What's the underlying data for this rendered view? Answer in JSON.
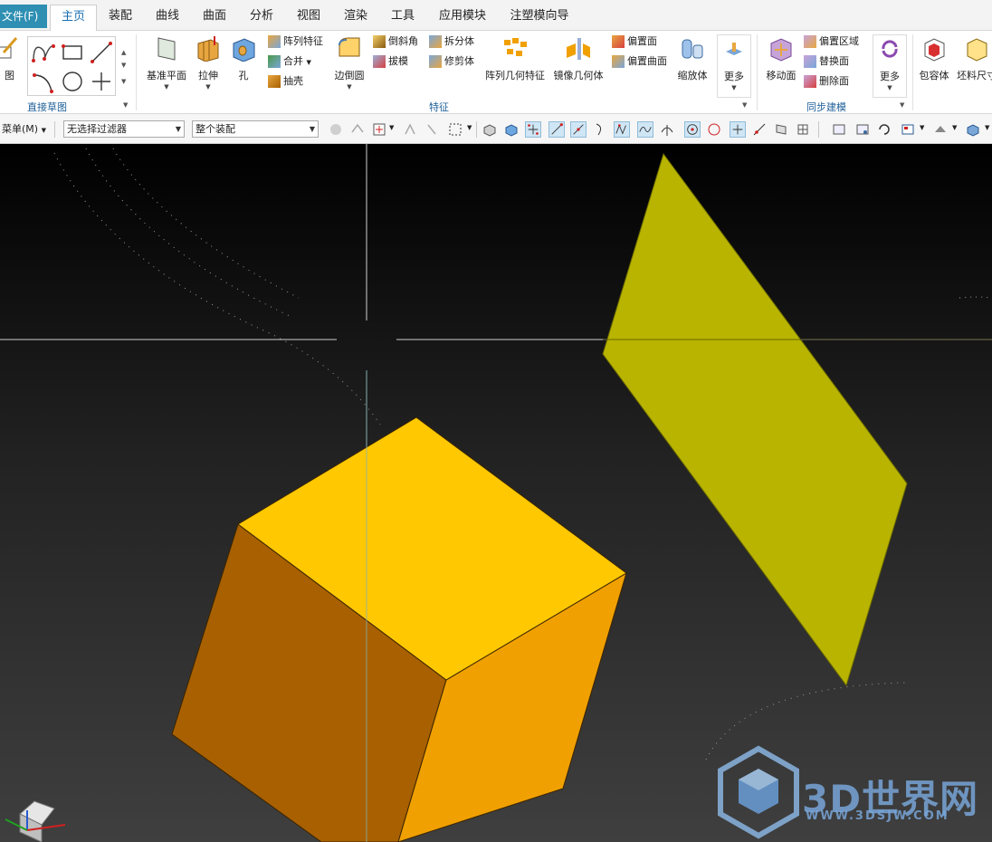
{
  "tabs": {
    "file": "文件(F)",
    "items": [
      "主页",
      "装配",
      "曲线",
      "曲面",
      "分析",
      "视图",
      "渲染",
      "工具",
      "应用模块",
      "注塑模向导"
    ],
    "active": "主页"
  },
  "ribbon": {
    "sketch_partial_label": "图",
    "groups": {
      "direct_sketch": "直接草图",
      "feature": "特征",
      "sync_modeling": "同步建模"
    },
    "feature": {
      "datum_plane": "基准平面",
      "extrude": "拉伸",
      "hole": "孔",
      "pattern_feature": "阵列特征",
      "unite": "合并",
      "shell": "抽壳",
      "edge_blend": "边倒圆",
      "chamfer": "倒斜角",
      "draft": "拔模",
      "split_body": "拆分体",
      "trim_body": "修剪体",
      "pattern_geometry": "阵列几何特征",
      "mirror_geometry": "镜像几何体",
      "offset_face": "偏置面",
      "offset_surface": "偏置曲面",
      "scale_body": "缩放体",
      "more": "更多"
    },
    "sync": {
      "move_face": "移动面",
      "offset_region": "偏置区域",
      "replace_face": "替换面",
      "delete_face": "删除面",
      "more": "更多"
    },
    "extra": {
      "bounding_body": "包容体",
      "stock_size": "坯料尺寸"
    }
  },
  "toolbar2": {
    "menu": "菜单(M)",
    "filter_value": "无选择过滤器",
    "scope_value": "整个装配"
  },
  "viewport": {
    "background_top": "#000000",
    "background_bottom": "#3f3f3f",
    "cube_top_color": "#ffc800",
    "cube_side_color": "#f0a000",
    "cube_front_color": "#a86000",
    "plane_color": "#b8b400"
  },
  "watermark": {
    "text": "3D世界网",
    "url": "WWW.3DSJW.COM"
  }
}
